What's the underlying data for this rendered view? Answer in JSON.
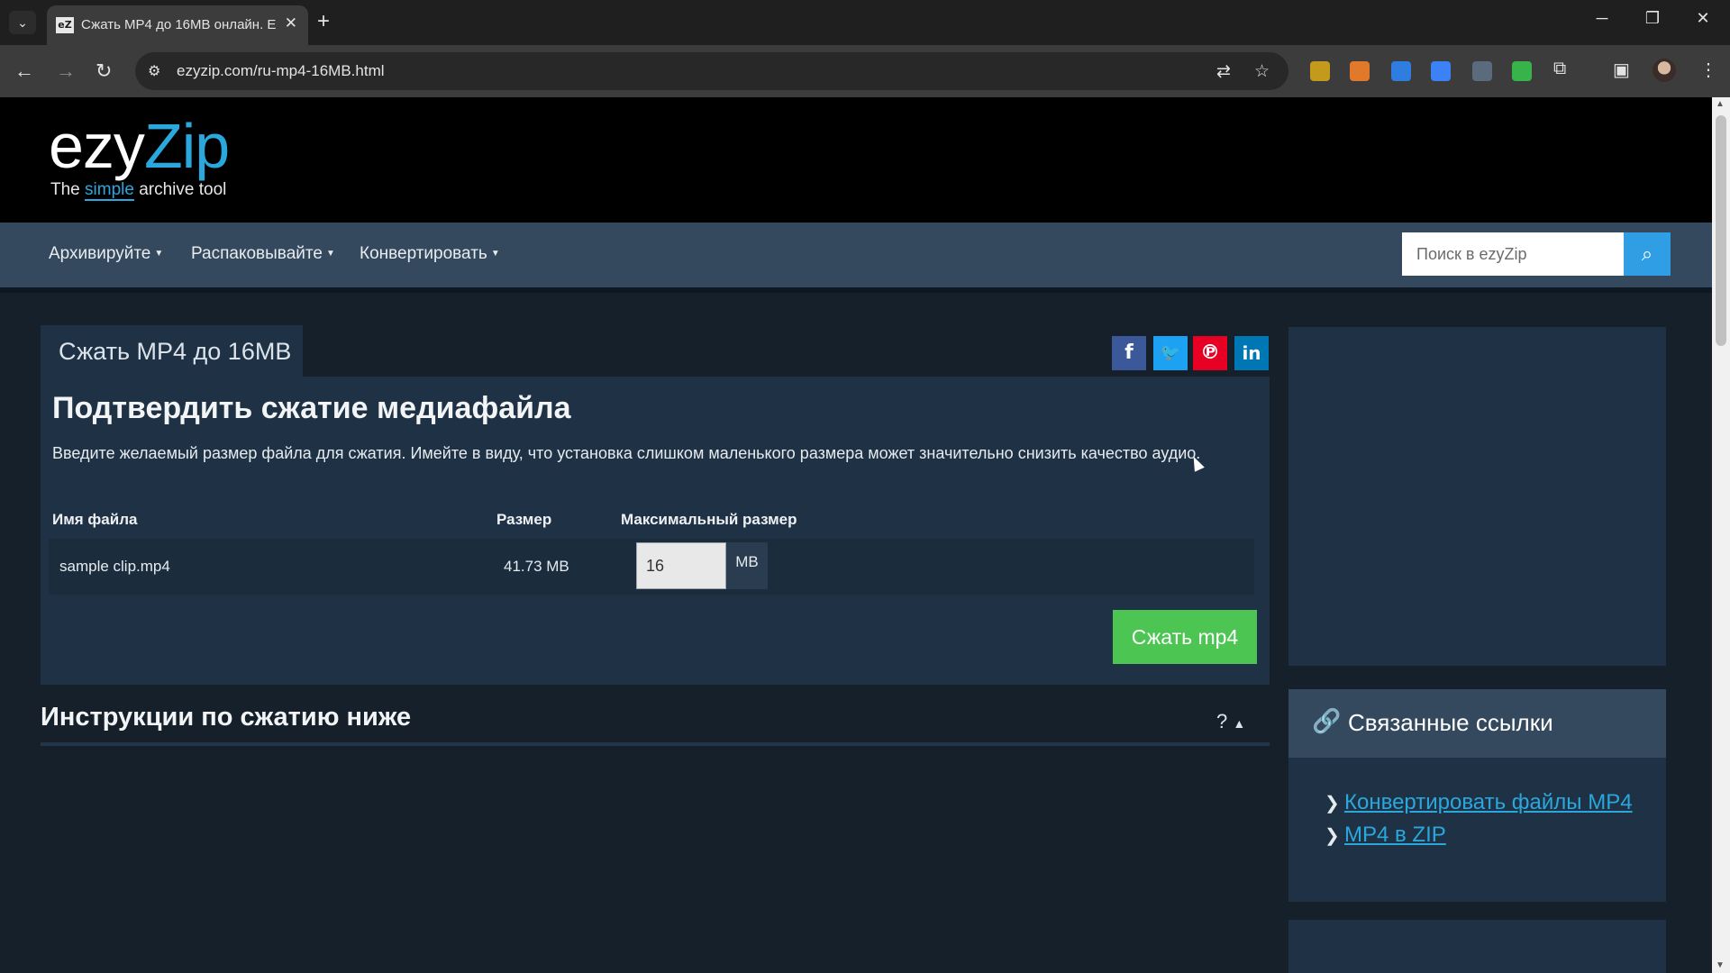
{
  "browser": {
    "tab_title": "Сжать MP4 до 16MB онлайн. E",
    "favicon_text": "eZ",
    "url": "ezyzip.com/ru-mp4-16MB.html",
    "icons": [
      "tab-search-icon",
      "close-icon",
      "new-tab-icon",
      "minimize-icon",
      "restore-icon",
      "close-window-icon",
      "back-icon",
      "forward-icon",
      "reload-icon",
      "site-info-icon",
      "translate-icon",
      "bookmark-star-icon",
      "extensions-icon",
      "side-panel-icon",
      "profile-avatar",
      "menu-icon"
    ]
  },
  "site": {
    "logo_ezy": "ezy",
    "logo_zip": "Zip",
    "tagline_pre": "The ",
    "tagline_simple": "simple",
    "tagline_post": " archive tool",
    "nav": [
      "Архивируйте",
      "Распаковывайте",
      "Конвертировать"
    ],
    "search_placeholder": "Поиск в ezyZip"
  },
  "main": {
    "tab_title": "Сжать MP4 до 16MB",
    "heading": "Подтвердить сжатие медиафайла",
    "description": "Введите желаемый размер файла для сжатия. Имейте в виду, что установка слишком маленького размера может значительно снизить качество аудио.",
    "columns": [
      "Имя файла",
      "Размер",
      "Максимальный размер"
    ],
    "file": {
      "name": "sample clip.mp4",
      "size": "41.73 MB",
      "max_size": "16",
      "unit": "MB"
    },
    "compress_button": "Сжать mp4",
    "instructions_heading": "Инструкции по сжатию ниже",
    "instructions_toggle": "?"
  },
  "sidebar": {
    "related_title": "Связанные ссылки",
    "links": [
      "Конвертировать файлы MP4",
      "MP4 в ZIP"
    ]
  },
  "colors": {
    "accent": "#2aa7dc",
    "button_green": "#4cc552",
    "card": "#1f3245",
    "nav": "#34495e"
  }
}
